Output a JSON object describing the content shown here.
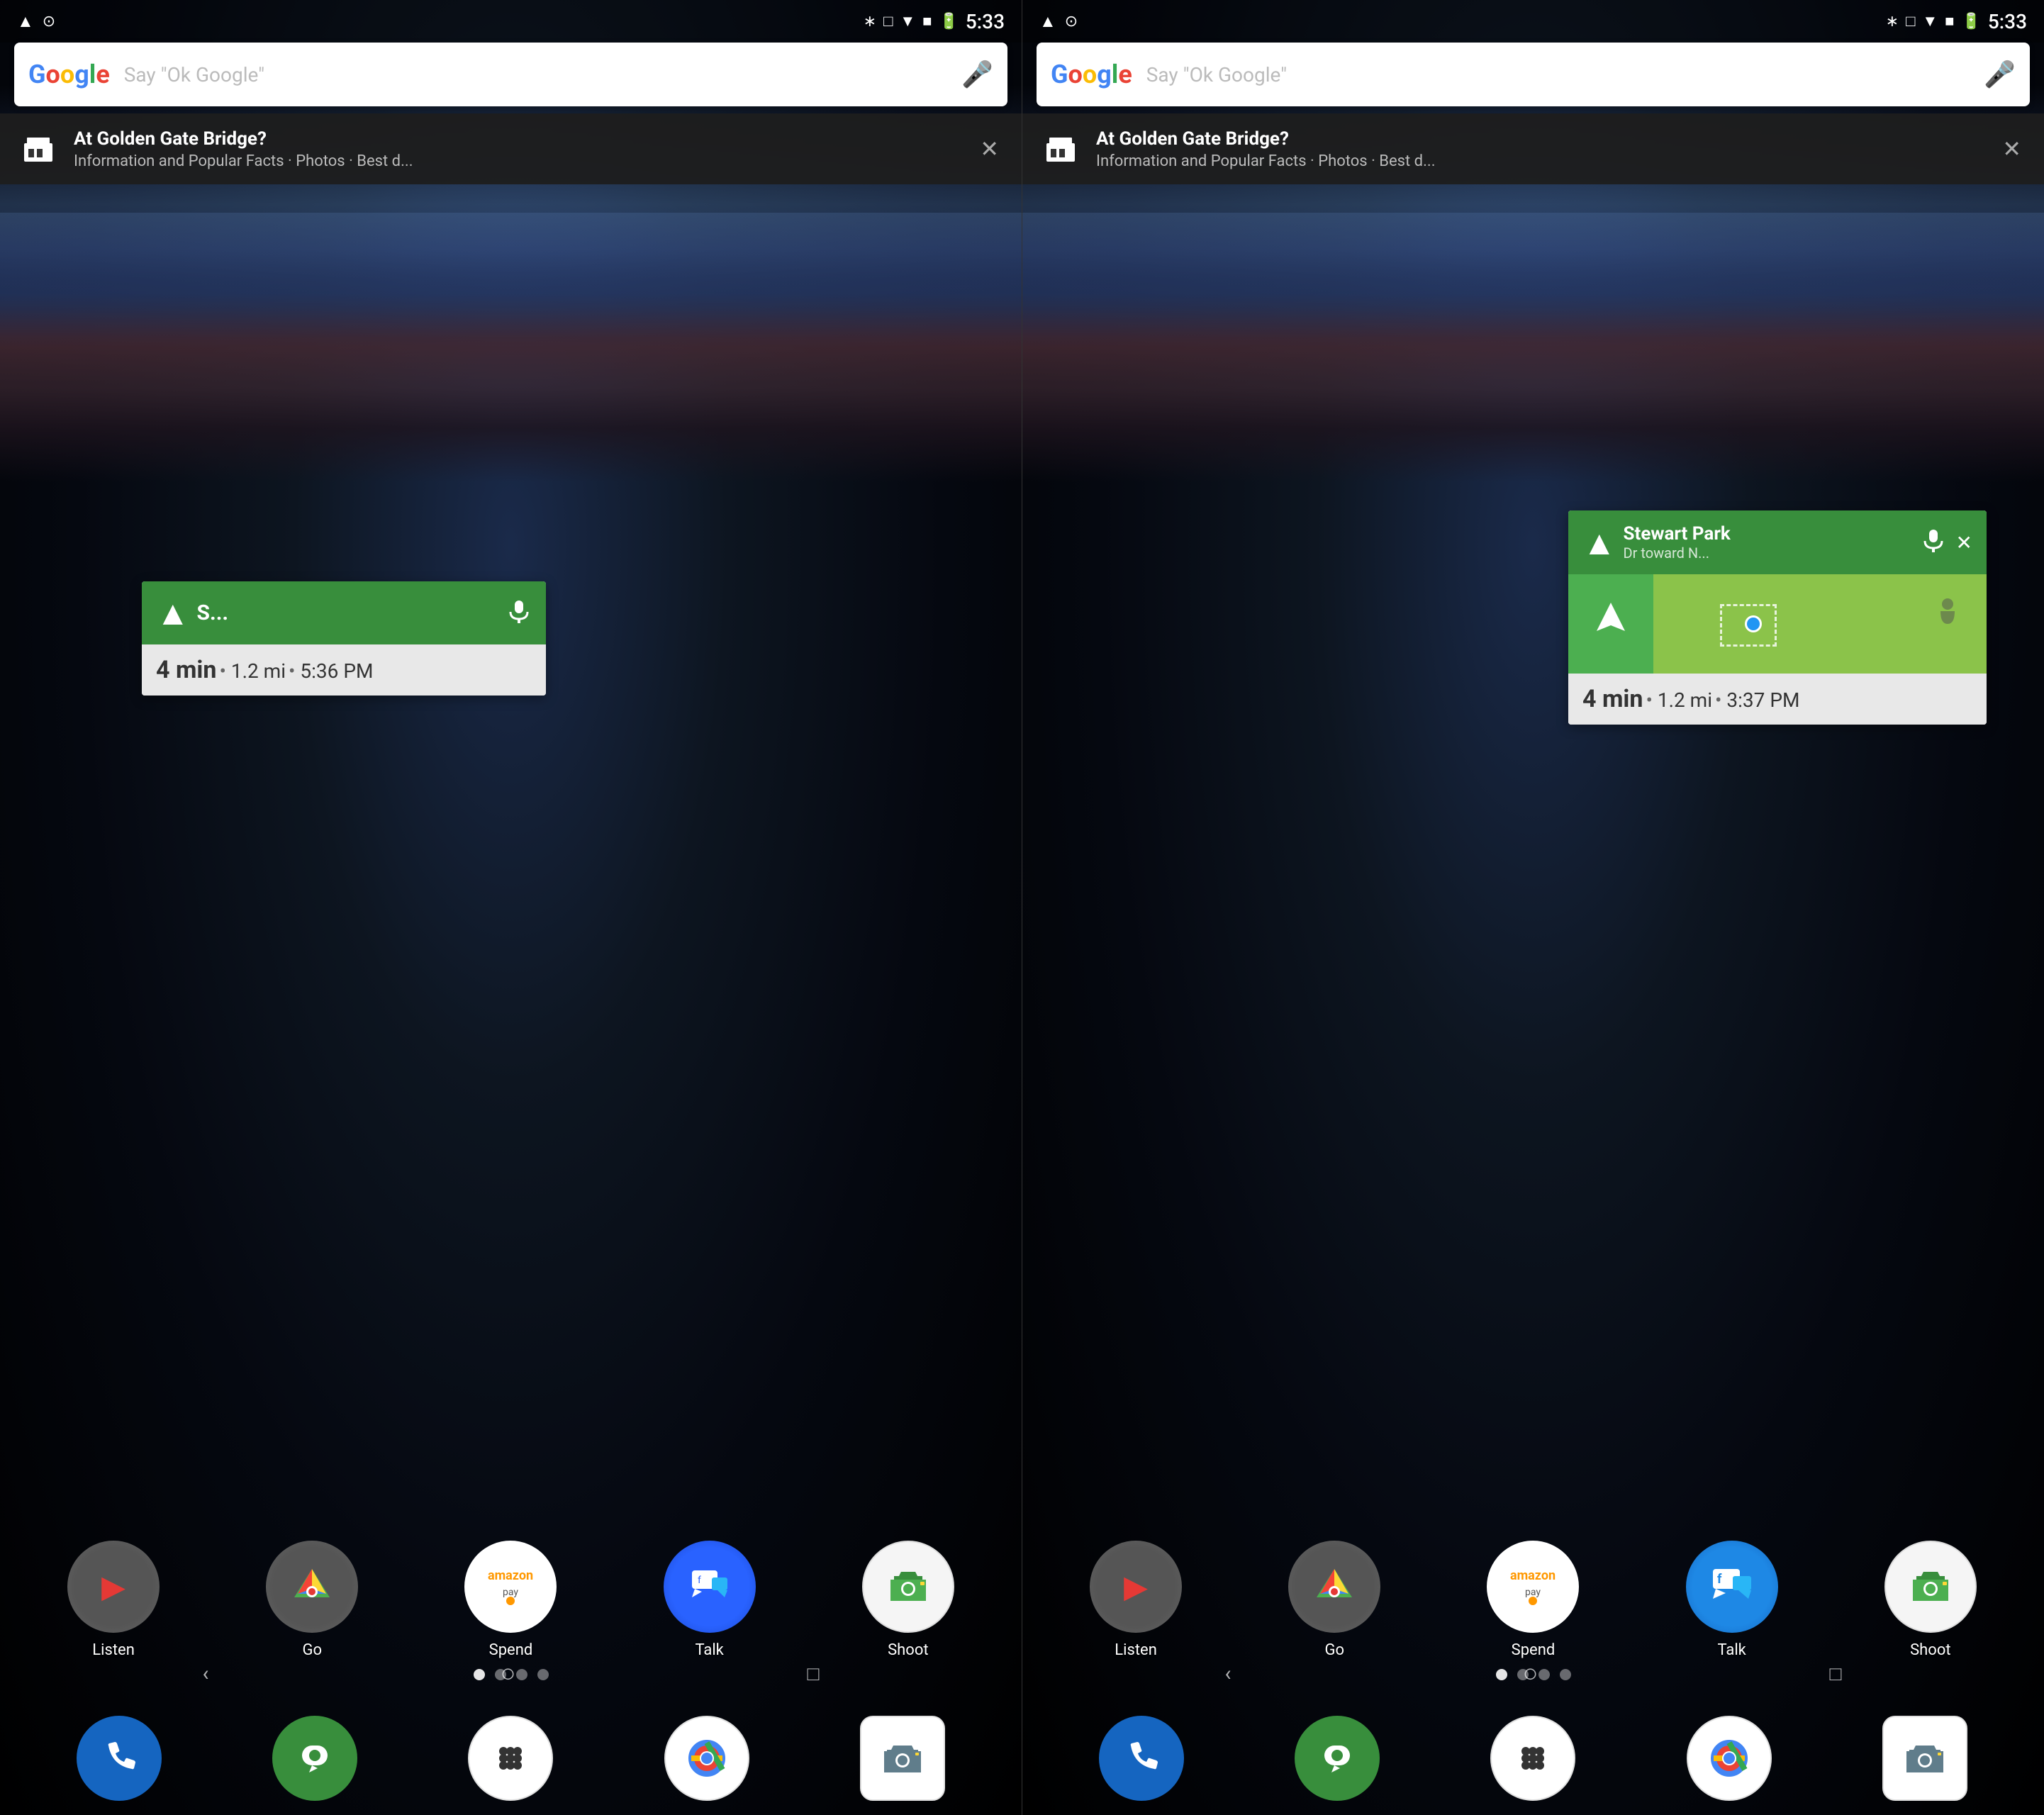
{
  "screens": [
    {
      "id": "left-screen",
      "status_bar": {
        "time": "5:33",
        "left_icons": [
          "location-arrow",
          "compass"
        ]
      },
      "search_bar": {
        "logo": "Google",
        "placeholder": "Say \"Ok Google\"",
        "mic_visible": true
      },
      "notification": {
        "title": "At Golden Gate Bridge?",
        "subtitle": "Information and Popular Facts · Photos · Best d..."
      },
      "nav_widget": {
        "visible": true,
        "destination": "S...",
        "eta": "4 min",
        "distance": "1.2 mi",
        "arrival": "5:36 PM"
      },
      "apps": [
        {
          "label": "Listen",
          "type": "listen"
        },
        {
          "label": "Go",
          "type": "go"
        },
        {
          "label": "Spend",
          "type": "spend"
        },
        {
          "label": "Talk",
          "type": "talk"
        },
        {
          "label": "Shoot",
          "type": "shoot"
        }
      ],
      "dock": [
        {
          "type": "phone"
        },
        {
          "type": "hangouts"
        },
        {
          "type": "apps"
        },
        {
          "type": "chrome"
        },
        {
          "type": "camera"
        }
      ]
    },
    {
      "id": "right-screen",
      "status_bar": {
        "time": "5:33",
        "left_icons": [
          "location-arrow",
          "compass"
        ]
      },
      "search_bar": {
        "logo": "Google",
        "placeholder": "Say \"Ok Google\"",
        "mic_visible": true
      },
      "notification": {
        "title": "At Golden Gate Bridge?",
        "subtitle": "Information and Popular Facts · Photos · Best d..."
      },
      "nav_widget": {
        "visible": true,
        "destination": "Stewart Park",
        "destination_sub": "Dr toward N...",
        "eta": "4 min",
        "distance": "1.2 mi",
        "arrival": "3:37 PM",
        "show_map": true
      },
      "apps": [
        {
          "label": "Listen",
          "type": "listen"
        },
        {
          "label": "Go",
          "type": "go"
        },
        {
          "label": "Spend",
          "type": "spend"
        },
        {
          "label": "Talk",
          "type": "talk"
        },
        {
          "label": "Shoot",
          "type": "shoot"
        }
      ],
      "dock": [
        {
          "type": "phone"
        },
        {
          "type": "hangouts"
        },
        {
          "type": "apps"
        },
        {
          "type": "chrome"
        },
        {
          "type": "camera"
        }
      ]
    }
  ]
}
